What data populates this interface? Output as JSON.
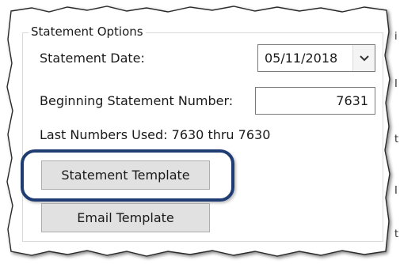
{
  "group": {
    "title": "Statement Options"
  },
  "fields": {
    "statement_date_label": "Statement Date:",
    "statement_date_value": "05/11/2018",
    "beginning_number_label": "Beginning Statement Number:",
    "beginning_number_value": "7631",
    "last_numbers_text": "Last Numbers Used: 7630 thru 7630"
  },
  "buttons": {
    "statement_template": "Statement Template",
    "email_template": "Email Template"
  },
  "right_edge_chars": [
    "i",
    "I",
    "t",
    "I",
    "t"
  ],
  "icons": {
    "date_dropdown": "chevron-down-icon"
  },
  "colors": {
    "highlight": "#1f3d73",
    "button_face": "#e1e1e1",
    "button_border": "#adadad"
  }
}
